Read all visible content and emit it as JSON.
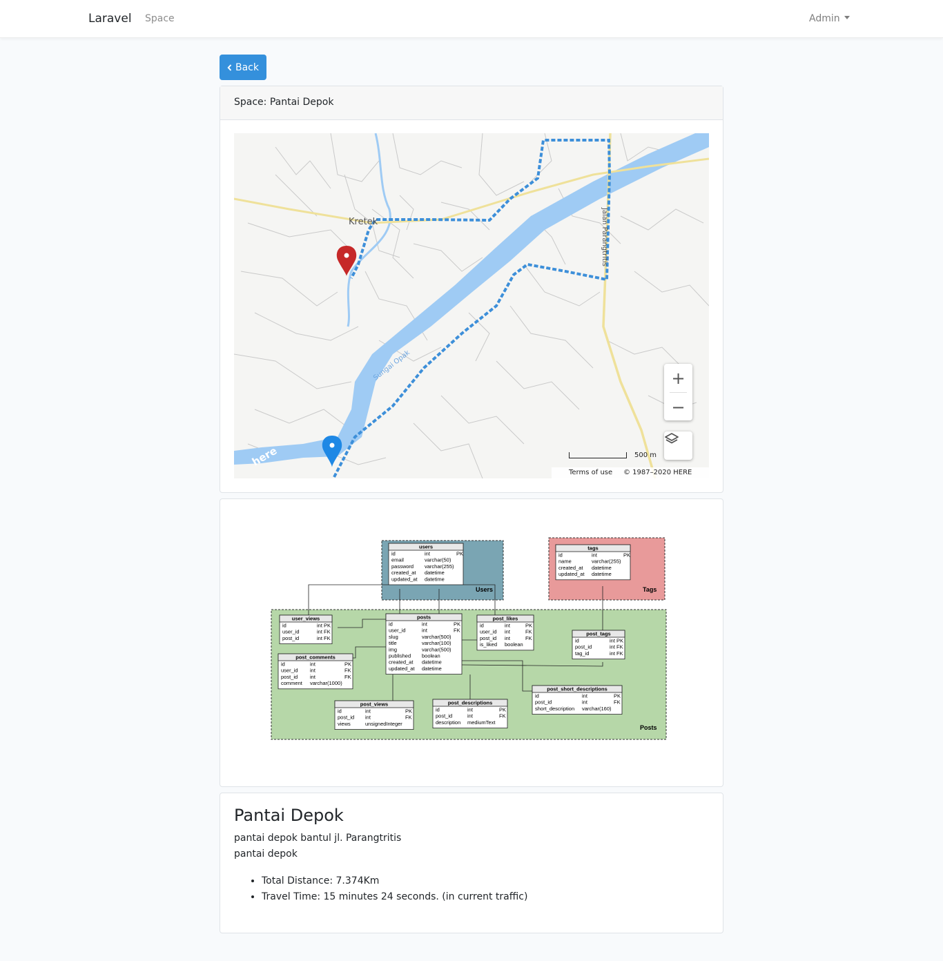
{
  "navbar": {
    "brand": "Laravel",
    "space_link": "Space",
    "user": "Admin"
  },
  "back_button": {
    "label": "Back",
    "icon": "chevron-left-icon"
  },
  "map_card": {
    "header": "Space: Pantai Depok",
    "map": {
      "place_label": "Kretek",
      "river_label": "Sungai Opak",
      "road_label": "Jalan Parangtritis",
      "zoom_in": "+",
      "zoom_out": "−",
      "scale_label": "500 m",
      "terms": "Terms of use",
      "copyright": "© 1987–2020 HERE",
      "logo": "here",
      "start_marker_color": "#c62828",
      "end_marker_color": "#1e88e5",
      "route_color": "#3d8fd9"
    }
  },
  "erd_card": {
    "groups": [
      {
        "name": "Users",
        "color": "#7aa5b3"
      },
      {
        "name": "Tags",
        "color": "#e89a9a"
      },
      {
        "name": "Posts",
        "color": "#b6d7a8"
      }
    ],
    "tables": {
      "users": {
        "title": "users",
        "rows": [
          [
            "id",
            "int",
            "PK"
          ],
          [
            "email",
            "varchar(50)",
            ""
          ],
          [
            "password",
            "varchar(255)",
            ""
          ],
          [
            "created_at",
            "datetime",
            ""
          ],
          [
            "updated_at",
            "datetime",
            ""
          ]
        ]
      },
      "tags": {
        "title": "tags",
        "rows": [
          [
            "id",
            "int",
            "PK"
          ],
          [
            "name",
            "varchar(255)",
            ""
          ],
          [
            "created_at",
            "datetime",
            ""
          ],
          [
            "updated_at",
            "datetime",
            ""
          ]
        ]
      },
      "user_views": {
        "title": "user_views",
        "rows": [
          [
            "id",
            "int PK",
            ""
          ],
          [
            "user_id",
            "int FK",
            ""
          ],
          [
            "post_id",
            "int FK",
            ""
          ]
        ]
      },
      "posts": {
        "title": "posts",
        "rows": [
          [
            "id",
            "int",
            "PK"
          ],
          [
            "user_id",
            "int",
            "FK"
          ],
          [
            "slug",
            "varchar(500)",
            ""
          ],
          [
            "title",
            "varchar(100)",
            ""
          ],
          [
            "img",
            "varchar(500)",
            ""
          ],
          [
            "published",
            "boolean",
            ""
          ],
          [
            "created_at",
            "datetime",
            ""
          ],
          [
            "updated_at",
            "datetime",
            ""
          ]
        ]
      },
      "post_likes": {
        "title": "post_likes",
        "rows": [
          [
            "id",
            "int",
            "PK"
          ],
          [
            "user_id",
            "int",
            "FK"
          ],
          [
            "post_id",
            "int",
            "FK"
          ],
          [
            "is_liked",
            "boolean",
            ""
          ]
        ]
      },
      "post_tags": {
        "title": "post_tags",
        "rows": [
          [
            "id",
            "int PK",
            ""
          ],
          [
            "post_id",
            "int FK",
            ""
          ],
          [
            "tag_id",
            "int FK",
            ""
          ]
        ]
      },
      "post_comments": {
        "title": "post_comments",
        "rows": [
          [
            "id",
            "int",
            "PK"
          ],
          [
            "user_id",
            "int",
            "FK"
          ],
          [
            "post_id",
            "int",
            "FK"
          ],
          [
            "comment",
            "varchar(1000)",
            ""
          ]
        ]
      },
      "post_short_descriptions": {
        "title": "post_short_descriptions",
        "rows": [
          [
            "id",
            "int",
            "PK"
          ],
          [
            "post_id",
            "int",
            "FK"
          ],
          [
            "short_description",
            "varchar(160)",
            ""
          ]
        ]
      },
      "post_views": {
        "title": "post_views",
        "rows": [
          [
            "id",
            "int",
            "PK"
          ],
          [
            "post_id",
            "int",
            "FK"
          ],
          [
            "views",
            "unsignedInteger",
            ""
          ]
        ]
      },
      "post_descriptions": {
        "title": "post_descriptions",
        "rows": [
          [
            "id",
            "int",
            "PK"
          ],
          [
            "post_id",
            "int",
            "FK"
          ],
          [
            "description",
            "mediumText",
            ""
          ]
        ]
      }
    }
  },
  "info_card": {
    "title": "Pantai Depok",
    "address": "pantai depok bantul jl. Parangtritis",
    "description": "pantai depok",
    "total_distance": "Total Distance: 7.374Km",
    "travel_time": "Travel Time: 15 minutes 24 seconds. (in current traffic)"
  }
}
